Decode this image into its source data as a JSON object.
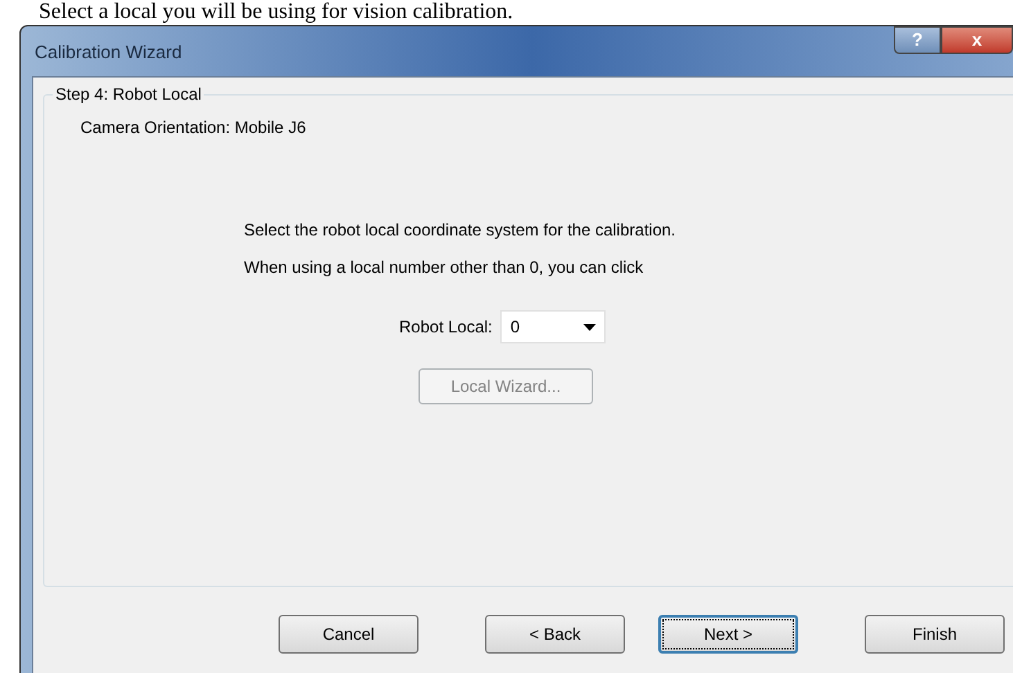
{
  "caption": "Select a local you will be using for vision calibration.",
  "window": {
    "title": "Calibration Wizard",
    "controls": [
      {
        "kind": "help",
        "label": "?"
      },
      {
        "kind": "close",
        "label": "x"
      }
    ]
  },
  "group": {
    "title": "Step 4: Robot Local",
    "orientation": "Camera Orientation: Mobile J6",
    "instructions": [
      "Select the robot local coordinate system for the calibration.",
      "When using a local number other than 0, you can click"
    ],
    "field": {
      "label": "Robot Local:",
      "value": "0"
    },
    "wizard_button": {
      "label": "Local Wizard...",
      "disabled": true
    }
  },
  "buttons": [
    {
      "label": "Cancel",
      "focused": false
    },
    {
      "label": "< Back",
      "focused": false
    },
    {
      "label": "Next >",
      "focused": true
    },
    {
      "label": "Finish",
      "focused": false
    }
  ]
}
